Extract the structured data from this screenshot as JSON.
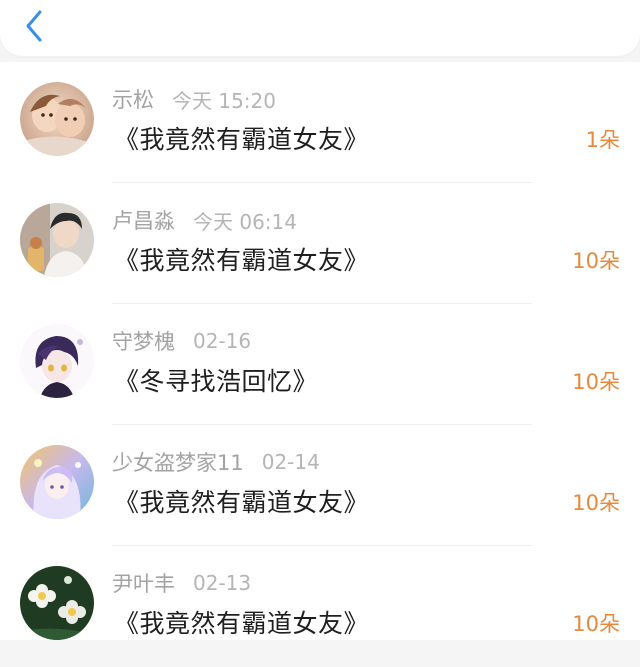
{
  "header": {
    "back_icon": "chevron-left-icon",
    "accent": "#3a8ee6"
  },
  "colors": {
    "amount": "#e9883a",
    "name": "#a3a3a3",
    "title": "#1f1f1f"
  },
  "records": [
    {
      "name": "示松",
      "time": "今天 15:20",
      "title": "《我竟然有霸道女友》",
      "amount": "1朵",
      "avatar_icon": "avatar-children-photo"
    },
    {
      "name": "卢昌淼",
      "time": "今天 06:14",
      "title": "《我竟然有霸道女友》",
      "amount": "10朵",
      "avatar_icon": "avatar-boy-photo"
    },
    {
      "name": "守梦槐",
      "time": "02-16",
      "title": "《冬寻找浩回忆》",
      "amount": "10朵",
      "avatar_icon": "avatar-anime-character"
    },
    {
      "name": "少女盗梦家11",
      "time": "02-14",
      "title": "《我竟然有霸道女友》",
      "amount": "10朵",
      "avatar_icon": "avatar-anime-girl"
    },
    {
      "name": "尹叶丰",
      "time": "02-13",
      "title": "《我竟然有霸道女友》",
      "amount": "10朵",
      "avatar_icon": "avatar-white-flowers"
    }
  ]
}
